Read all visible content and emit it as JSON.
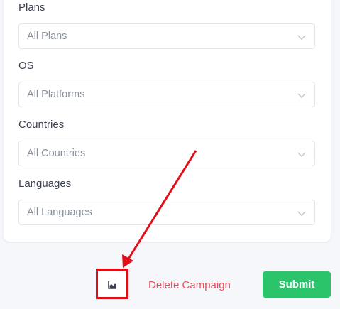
{
  "filters": [
    {
      "label": "Plans",
      "value": "All Plans"
    },
    {
      "label": "OS",
      "value": "All Platforms"
    },
    {
      "label": "Countries",
      "value": "All Countries"
    },
    {
      "label": "Languages",
      "value": "All Languages"
    }
  ],
  "actions": {
    "chart_icon": "area-chart-icon",
    "delete_label": "Delete Campaign",
    "submit_label": "Submit"
  },
  "colors": {
    "submit": "#2bc46b",
    "delete": "#e9505b",
    "highlight": "#e10e1a"
  }
}
